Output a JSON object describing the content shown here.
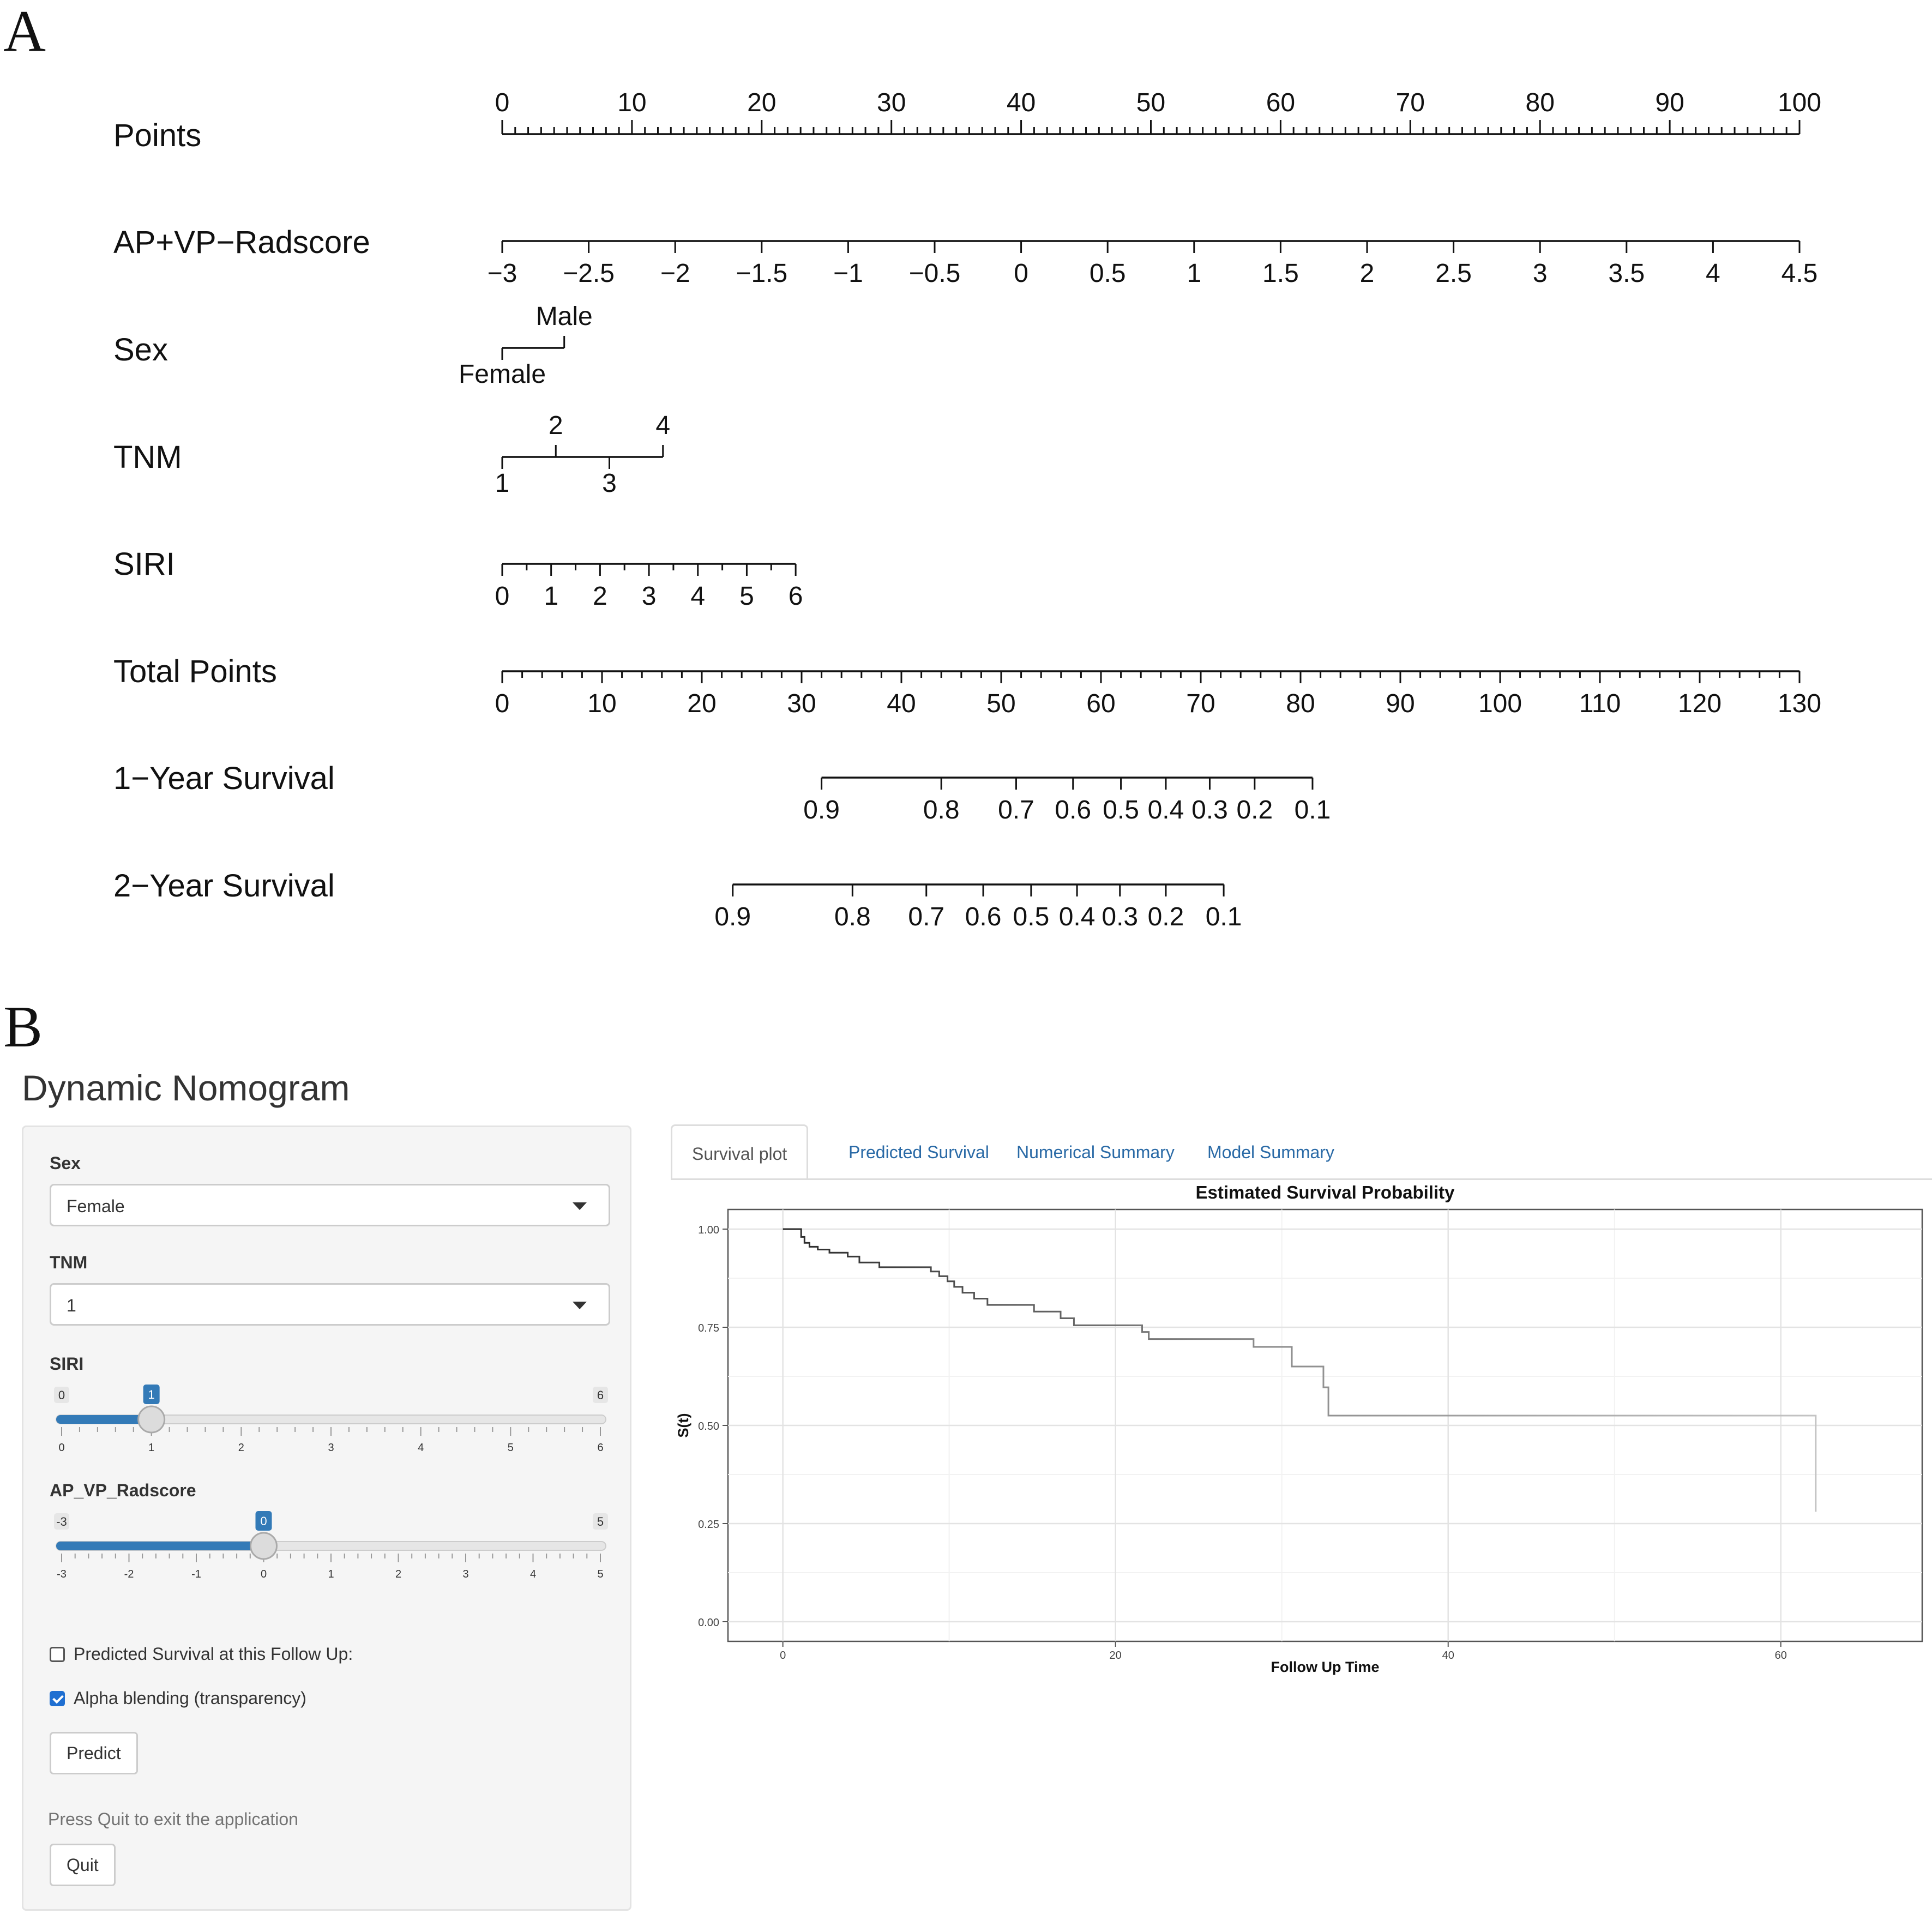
{
  "panel_labels": {
    "a": "A",
    "b": "B"
  },
  "nomogram": {
    "rows": [
      {
        "label": "Points"
      },
      {
        "label": "AP+VP−Radscore"
      },
      {
        "label": "Sex"
      },
      {
        "label": "TNM"
      },
      {
        "label": "SIRI"
      },
      {
        "label": "Total Points"
      },
      {
        "label": "1−Year Survival"
      },
      {
        "label": "2−Year Survival"
      }
    ],
    "axes": {
      "points": {
        "min": 0,
        "max": 100,
        "labels": [
          "0",
          "10",
          "20",
          "30",
          "40",
          "50",
          "60",
          "70",
          "80",
          "90",
          "100"
        ]
      },
      "radscore": {
        "labels": [
          "−3",
          "−2.5",
          "−2",
          "−1.5",
          "−1",
          "−0.5",
          "0",
          "0.5",
          "1",
          "1.5",
          "2",
          "2.5",
          "3",
          "3.5",
          "4",
          "4.5"
        ]
      },
      "sex": {
        "top": [
          "Male"
        ],
        "bottom": [
          "Female"
        ]
      },
      "tnm": {
        "top": [
          "2",
          "4"
        ],
        "bottom": [
          "1",
          "3"
        ]
      },
      "siri": {
        "labels": [
          "0",
          "1",
          "2",
          "3",
          "4",
          "5",
          "6"
        ]
      },
      "total_points": {
        "min": 0,
        "max": 130,
        "labels": [
          "0",
          "10",
          "20",
          "30",
          "40",
          "50",
          "60",
          "70",
          "80",
          "90",
          "100",
          "110",
          "120",
          "130"
        ]
      },
      "survival_1yr": {
        "labels": [
          "0.9",
          "0.8",
          "0.7",
          "0.6",
          "0.5",
          "0.4",
          "0.3",
          "0.2",
          "0.1"
        ],
        "total_points_at_label": [
          32,
          44,
          51.5,
          57.2,
          62,
          66.5,
          70.9,
          75.4,
          81.2
        ]
      },
      "survival_2yr": {
        "labels": [
          "0.9",
          "0.8",
          "0.7",
          "0.6",
          "0.5",
          "0.4",
          "0.3",
          "0.2",
          "0.1"
        ],
        "total_points_at_label": [
          23.1,
          35.1,
          42.5,
          48.2,
          53,
          57.6,
          61.9,
          66.5,
          72.3
        ]
      }
    }
  },
  "app": {
    "title": "Dynamic Nomogram",
    "sidebar": {
      "sex": {
        "label": "Sex",
        "value": "Female"
      },
      "tnm": {
        "label": "TNM",
        "value": "1"
      },
      "siri": {
        "label": "SIRI",
        "min": 0,
        "max": 6,
        "value": 1,
        "min_label": "0",
        "max_label": "6",
        "value_label": "1",
        "tick_labels": [
          "0",
          "1",
          "2",
          "3",
          "4",
          "5",
          "6"
        ]
      },
      "radscore": {
        "label": "AP_VP_Radscore",
        "min": -3,
        "max": 5,
        "value": 0,
        "min_label": "-3",
        "max_label": "5",
        "value_label": "0",
        "tick_labels": [
          "-3",
          "-2",
          "-1",
          "0",
          "1",
          "2",
          "3",
          "4",
          "5"
        ]
      },
      "predicted_checkbox": {
        "label": "Predicted Survival at this Follow Up:",
        "checked": false
      },
      "alpha_checkbox": {
        "label": "Alpha blending (transparency)",
        "checked": true
      },
      "predict_button": "Predict",
      "help_text": "Press Quit to exit the application",
      "quit_button": "Quit"
    },
    "tabs": [
      {
        "label": "Survival plot",
        "active": true
      },
      {
        "label": "Predicted Survival",
        "active": false
      },
      {
        "label": "Numerical Summary",
        "active": false
      },
      {
        "label": "Model Summary",
        "active": false
      }
    ],
    "accent_color": "#337ab7",
    "link_color": "#2a6aa6"
  },
  "chart_data": {
    "type": "line",
    "title": "Estimated Survival Probability",
    "xlabel": "Follow Up Time",
    "ylabel": "S(t)",
    "xlim": [
      -3.3,
      68.5
    ],
    "ylim": [
      -0.05,
      1.05
    ],
    "xticks": [
      0,
      20,
      40,
      60
    ],
    "xtick_labels": [
      "0",
      "20",
      "40",
      "60"
    ],
    "yticks": [
      0,
      0.25,
      0.5,
      0.75,
      1
    ],
    "ytick_labels": [
      "0.00",
      "0.25",
      "0.50",
      "0.75",
      "1.00"
    ],
    "grid": true,
    "series": [
      {
        "step": true,
        "x": [
          0,
          1.1,
          1.3,
          1.6,
          2.1,
          2.8,
          3.9,
          4.6,
          5.8,
          8.9,
          9.4,
          9.9,
          10.3,
          10.8,
          11.5,
          12.3,
          15.1,
          16.7,
          17.5,
          21.6,
          22,
          28.3,
          30.6,
          32.5,
          32.8,
          62.1,
          62.1
        ],
        "y": [
          1.0,
          0.98,
          0.965,
          0.955,
          0.948,
          0.94,
          0.93,
          0.915,
          0.903,
          0.892,
          0.88,
          0.867,
          0.853,
          0.838,
          0.823,
          0.807,
          0.79,
          0.773,
          0.755,
          0.738,
          0.72,
          0.7,
          0.65,
          0.597,
          0.525,
          0.45,
          0.28
        ],
        "color_start": "#2a2a2a",
        "color_end": "#c4c4c4"
      }
    ]
  }
}
